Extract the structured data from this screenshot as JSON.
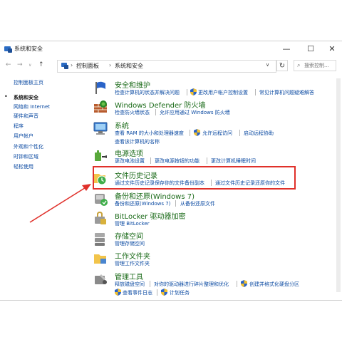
{
  "window": {
    "title": "系统和安全",
    "controls": {
      "minimize": "—",
      "maximize": "☐",
      "close": "✕"
    }
  },
  "address": {
    "back": "←",
    "forward": "→",
    "up": "↑",
    "dropdown": "∨",
    "breadcrumbs": [
      "控制面板",
      "系统和安全"
    ],
    "separator": "›",
    "refresh": "↻",
    "search_placeholder": "搜索控制..."
  },
  "sidebar": {
    "items": [
      {
        "label": "控制面板主页"
      },
      {
        "label": "系统和安全",
        "active": true
      },
      {
        "label": "网络和 Internet"
      },
      {
        "label": "硬件和声音"
      },
      {
        "label": "程序"
      },
      {
        "label": "用户帐户"
      },
      {
        "label": "外观和个性化"
      },
      {
        "label": "时钟和区域"
      },
      {
        "label": "轻松使用"
      }
    ]
  },
  "categories": [
    {
      "title": "安全和维护",
      "links": [
        "检查计算机的状态并解决问题",
        "更改用户帐户控制设置",
        "常见计算机问题疑难解答"
      ]
    },
    {
      "title": "Windows Defender 防火墙",
      "links": [
        "检查防火墙状态",
        "允许应用通过 Windows 防火墙"
      ]
    },
    {
      "title": "系统",
      "links": [
        "查看 RAM 的大小和处理器速度",
        "允许远程访问",
        "启动远程协助",
        "查看该计算机的名称"
      ]
    },
    {
      "title": "电源选项",
      "links": [
        "更改电池设置",
        "更改电源按钮的功能",
        "更改计算机睡眠时间"
      ]
    },
    {
      "title": "文件历史记录",
      "links": [
        "通过文件历史记录保存你的文件备份副本",
        "通过文件历史记录还原你的文件"
      ]
    },
    {
      "title": "备份和还原(Windows 7)",
      "links": [
        "备份和还原(Windows 7)",
        "从备份还原文件"
      ]
    },
    {
      "title": "BitLocker 驱动器加密",
      "links": [
        "管理 BitLocker"
      ]
    },
    {
      "title": "存储空间",
      "links": [
        "管理存储空间"
      ]
    },
    {
      "title": "工作文件夹",
      "links": [
        "管理工作文件夹"
      ]
    },
    {
      "title": "管理工具",
      "links": [
        "释放磁盘空间",
        "对你的驱动器进行碎片整理和优化",
        "创建并格式化硬盘分区",
        "查看事件日志",
        "计划任务"
      ]
    }
  ],
  "colors": {
    "category_title": "#1a6a18",
    "link": "#0b4aa2",
    "highlight_box": "#e0302a",
    "annotation_arrow": "#e0302a"
  }
}
